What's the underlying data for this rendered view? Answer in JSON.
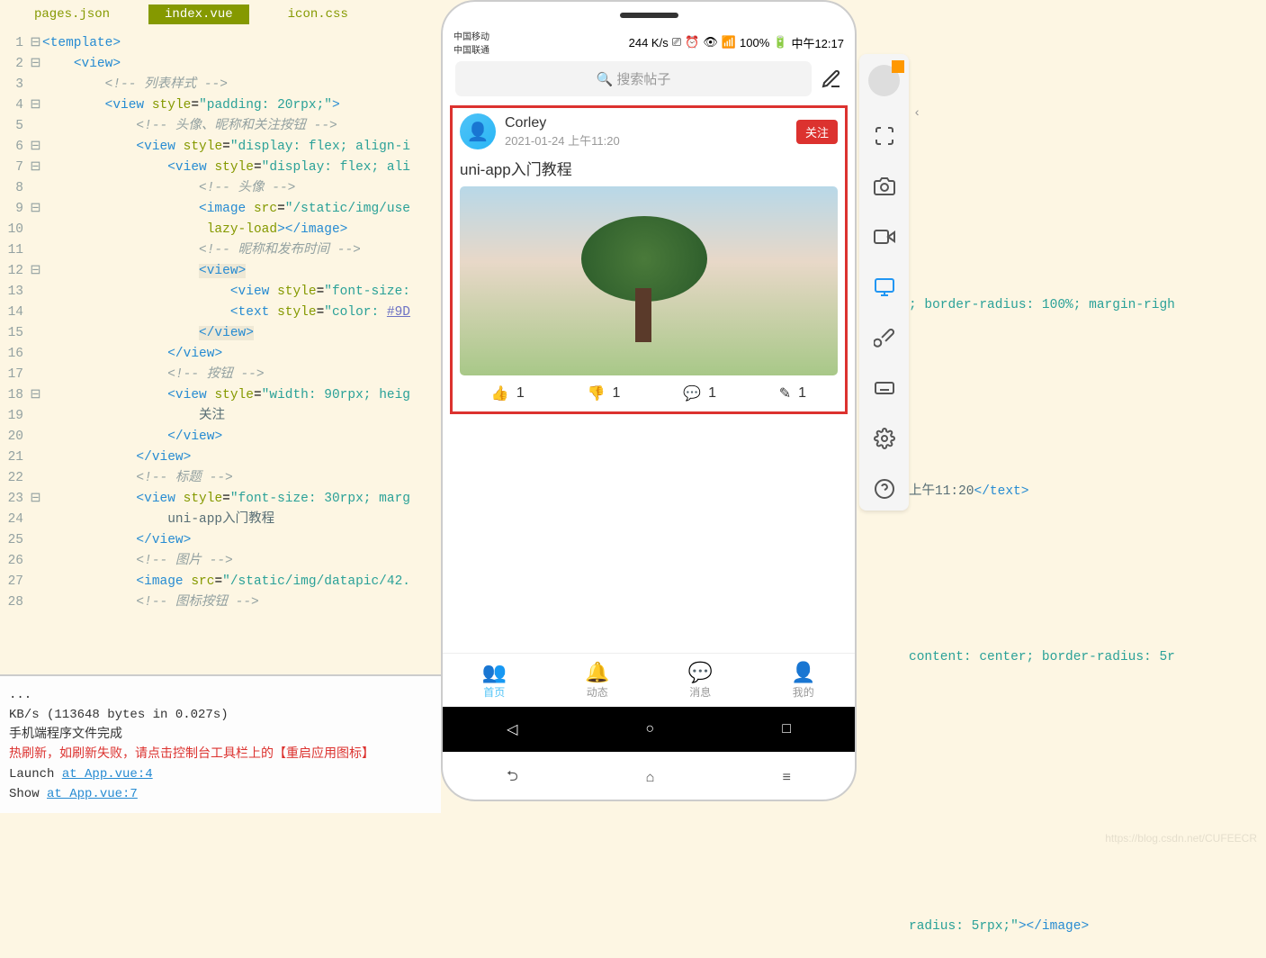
{
  "tabs": {
    "pages": "pages.json",
    "index": "index.vue",
    "icon": "icon.css"
  },
  "code": {
    "lines": [
      {
        "n": "1",
        "f": "⊟",
        "c": "<template>"
      },
      {
        "n": "2",
        "f": "⊟",
        "c": "    <view>"
      },
      {
        "n": "3",
        "f": "",
        "c": "        <!-- 列表样式 -->"
      },
      {
        "n": "4",
        "f": "⊟",
        "c": "        <view style=\"padding: 20rpx;\">"
      },
      {
        "n": "5",
        "f": "",
        "c": "            <!-- 头像、昵称和关注按钮 -->"
      },
      {
        "n": "6",
        "f": "⊟",
        "c": "            <view style=\"display: flex; align-i"
      },
      {
        "n": "7",
        "f": "⊟",
        "c": "                <view style=\"display: flex; ali"
      },
      {
        "n": "8",
        "f": "",
        "c": "                    <!-- 头像 -->"
      },
      {
        "n": "9",
        "f": "⊟",
        "c": "                    <image src=\"/static/img/use"
      },
      {
        "n": "10",
        "f": "",
        "c": "                     lazy-load></image>"
      },
      {
        "n": "11",
        "f": "",
        "c": "                    <!-- 昵称和发布时间 -->"
      },
      {
        "n": "12",
        "f": "⊟",
        "c": "                    <view>"
      },
      {
        "n": "13",
        "f": "",
        "c": "                        <view style=\"font-size:"
      },
      {
        "n": "14",
        "f": "",
        "c": "                        <text style=\"color: #9D"
      },
      {
        "n": "15",
        "f": "",
        "c": "                    </view>"
      },
      {
        "n": "16",
        "f": "",
        "c": "                </view>"
      },
      {
        "n": "17",
        "f": "",
        "c": "                <!-- 按钮 -->"
      },
      {
        "n": "18",
        "f": "⊟",
        "c": "                <view style=\"width: 90rpx; heig"
      },
      {
        "n": "19",
        "f": "",
        "c": "                    关注"
      },
      {
        "n": "20",
        "f": "",
        "c": "                </view>"
      },
      {
        "n": "21",
        "f": "",
        "c": "            </view>"
      },
      {
        "n": "22",
        "f": "",
        "c": "            <!-- 标题 -->"
      },
      {
        "n": "23",
        "f": "⊟",
        "c": "            <view style=\"font-size: 30rpx; marg"
      },
      {
        "n": "24",
        "f": "",
        "c": "                uni-app入门教程"
      },
      {
        "n": "25",
        "f": "",
        "c": "            </view>"
      },
      {
        "n": "26",
        "f": "",
        "c": "            <!-- 图片 -->"
      },
      {
        "n": "27",
        "f": "",
        "c": "            <image src=\"/static/img/datapic/42."
      },
      {
        "n": "28",
        "f": "",
        "c": "            <!-- 图标按钮 -->"
      }
    ]
  },
  "code_right": {
    "l9": "; border-radius: 100%; margin-righ",
    "l14": "上午11:20</text>",
    "l18": "content: center; border-radius: 5r",
    "l27": "radius: 5rpx;\"></image>"
  },
  "console": {
    "dots": "...",
    "l1": " KB/s (113648 bytes in 0.027s)",
    "l2": "手机端程序文件完成",
    "l3": "热刷新，如刷新失败，请点击控制台工具栏上的【重启应用图标】",
    "l4a": "Launch ",
    "l4b": "at App.vue:4",
    "l5a": "Show ",
    "l5b": "at App.vue:7"
  },
  "phone": {
    "status": {
      "carrier1": "中国移动",
      "carrier2": "中国联通",
      "speed": "244 K/s",
      "battery": "100%",
      "time": "中午12:17"
    },
    "search_placeholder": "搜索帖子",
    "card": {
      "username": "Corley",
      "timestamp": "2021-01-24 上午11:20",
      "follow": "关注",
      "title": "uni-app入门教程",
      "actions": {
        "like": "1",
        "dislike": "1",
        "comment": "1",
        "share": "1"
      }
    },
    "tabbar": {
      "home": "首页",
      "feed": "动态",
      "msg": "消息",
      "me": "我的"
    }
  },
  "watermark": "https://blog.csdn.net/CUFEECR"
}
